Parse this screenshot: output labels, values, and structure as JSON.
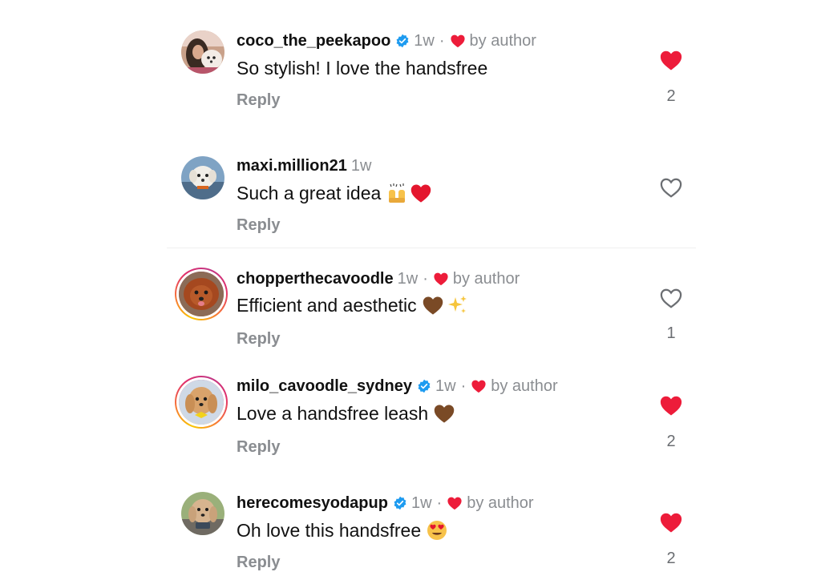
{
  "colors": {
    "like_red": "#ed1c3a",
    "muted_text": "#8a8d91",
    "verified_blue": "#1d9bf0",
    "story_ring": [
      "#f9c700",
      "#e1306c",
      "#c13584"
    ]
  },
  "comments": [
    {
      "username": "coco_the_peekapoo",
      "verified": true,
      "age": "1w",
      "separator": "·",
      "liked_by_author": true,
      "by_author_label": "by author",
      "text": "So stylish! I love the handsfree",
      "emojis": [],
      "reply_label": "Reply",
      "liked": true,
      "like_count": "2",
      "avatar_icon": "avatar-woman-with-dog"
    },
    {
      "username": "maxi.million21",
      "verified": false,
      "age": "1w",
      "text": "Such a great idea",
      "emojis": [
        "raising-hands-emoji",
        "red-heart-emoji"
      ],
      "reply_label": "Reply",
      "liked": false,
      "like_count": "",
      "avatar_icon": "avatar-white-dog"
    },
    {
      "username": "chopperthecavoodle",
      "verified": false,
      "age": "1w",
      "separator": "·",
      "liked_by_author": true,
      "by_author_label": "by author",
      "text": "Efficient and aesthetic",
      "emojis": [
        "brown-heart-emoji",
        "sparkles-emoji"
      ],
      "reply_label": "Reply",
      "liked": false,
      "like_count": "1",
      "avatar_icon": "avatar-red-cavoodle",
      "story_ring": true
    },
    {
      "username": "milo_cavoodle_sydney",
      "verified": true,
      "age": "1w",
      "separator": "·",
      "liked_by_author": true,
      "by_author_label": "by author",
      "text": "Love a handsfree leash",
      "emojis": [
        "brown-heart-emoji"
      ],
      "reply_label": "Reply",
      "liked": true,
      "like_count": "2",
      "avatar_icon": "avatar-cavoodle-yellow-bow",
      "story_ring": true
    },
    {
      "username": "herecomesyodapup",
      "verified": true,
      "age": "1w",
      "separator": "·",
      "liked_by_author": true,
      "by_author_label": "by author",
      "text": "Oh love this handsfree",
      "emojis": [
        "heart-eyes-emoji"
      ],
      "reply_label": "Reply",
      "liked": true,
      "like_count": "2",
      "avatar_icon": "avatar-poodle-outdoors"
    }
  ]
}
